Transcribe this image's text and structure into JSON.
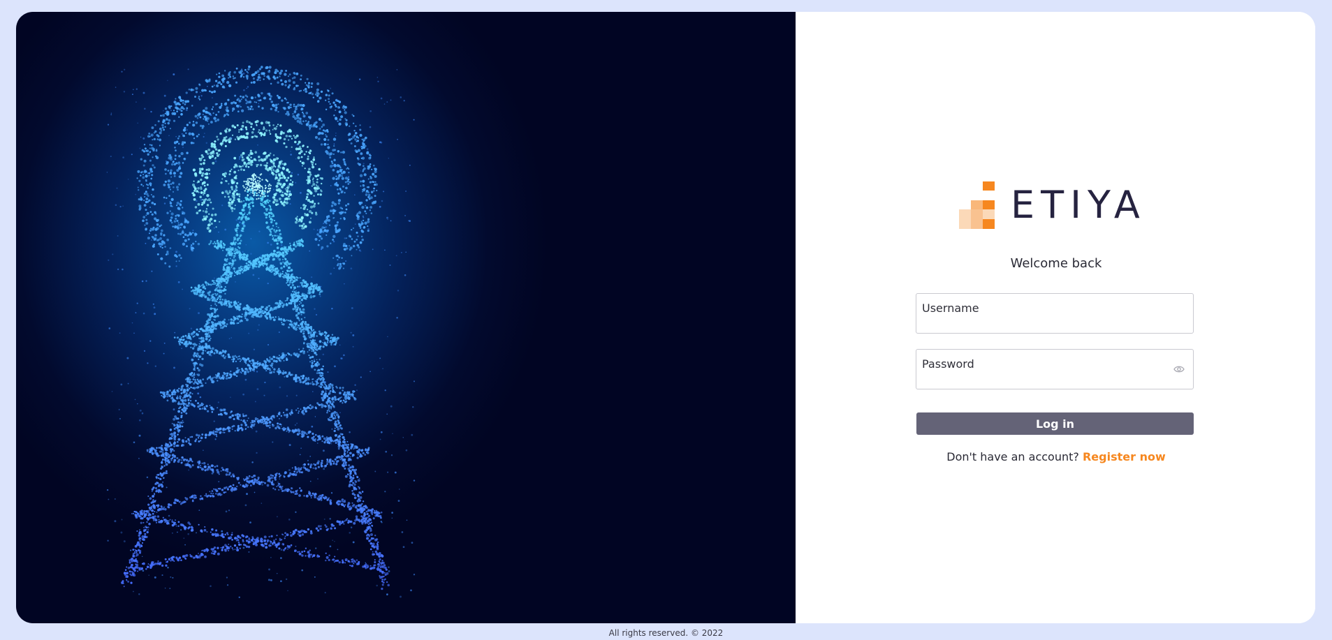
{
  "brand": {
    "name": "ETIYA",
    "accent_color": "#f6871f",
    "text_color": "#262340"
  },
  "login": {
    "welcome": "Welcome back",
    "username_label": "Username",
    "password_label": "Password",
    "login_button": "Log in",
    "register_prompt": "Don't have an account?",
    "register_link": "Register now"
  },
  "hero": {
    "illustration": "signal-tower-icon",
    "glow_color": "#2ad4f0"
  },
  "footer": {
    "text": "All rights reserved. © 2022"
  }
}
